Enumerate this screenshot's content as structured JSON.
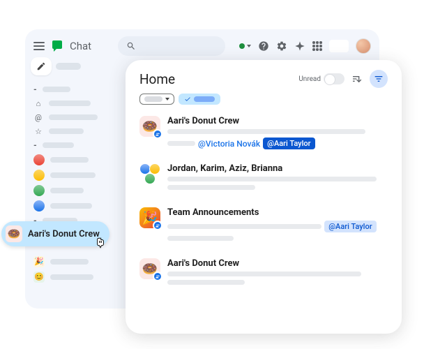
{
  "brand": "Chat",
  "panel": {
    "title": "Home",
    "unread_label": "Unread"
  },
  "conversations": [
    {
      "title": "Aari's Donut Crew",
      "mention1": "@Victoria Novák",
      "mention2": "@Aari Taylor"
    },
    {
      "title": "Jordan, Karim, Aziz, Brianna"
    },
    {
      "title": "Team Announcements",
      "mention_light": "@Aari Taylor"
    },
    {
      "title": "Aari's Donut Crew"
    }
  ],
  "hover_chip": "Aari's Donut Crew"
}
